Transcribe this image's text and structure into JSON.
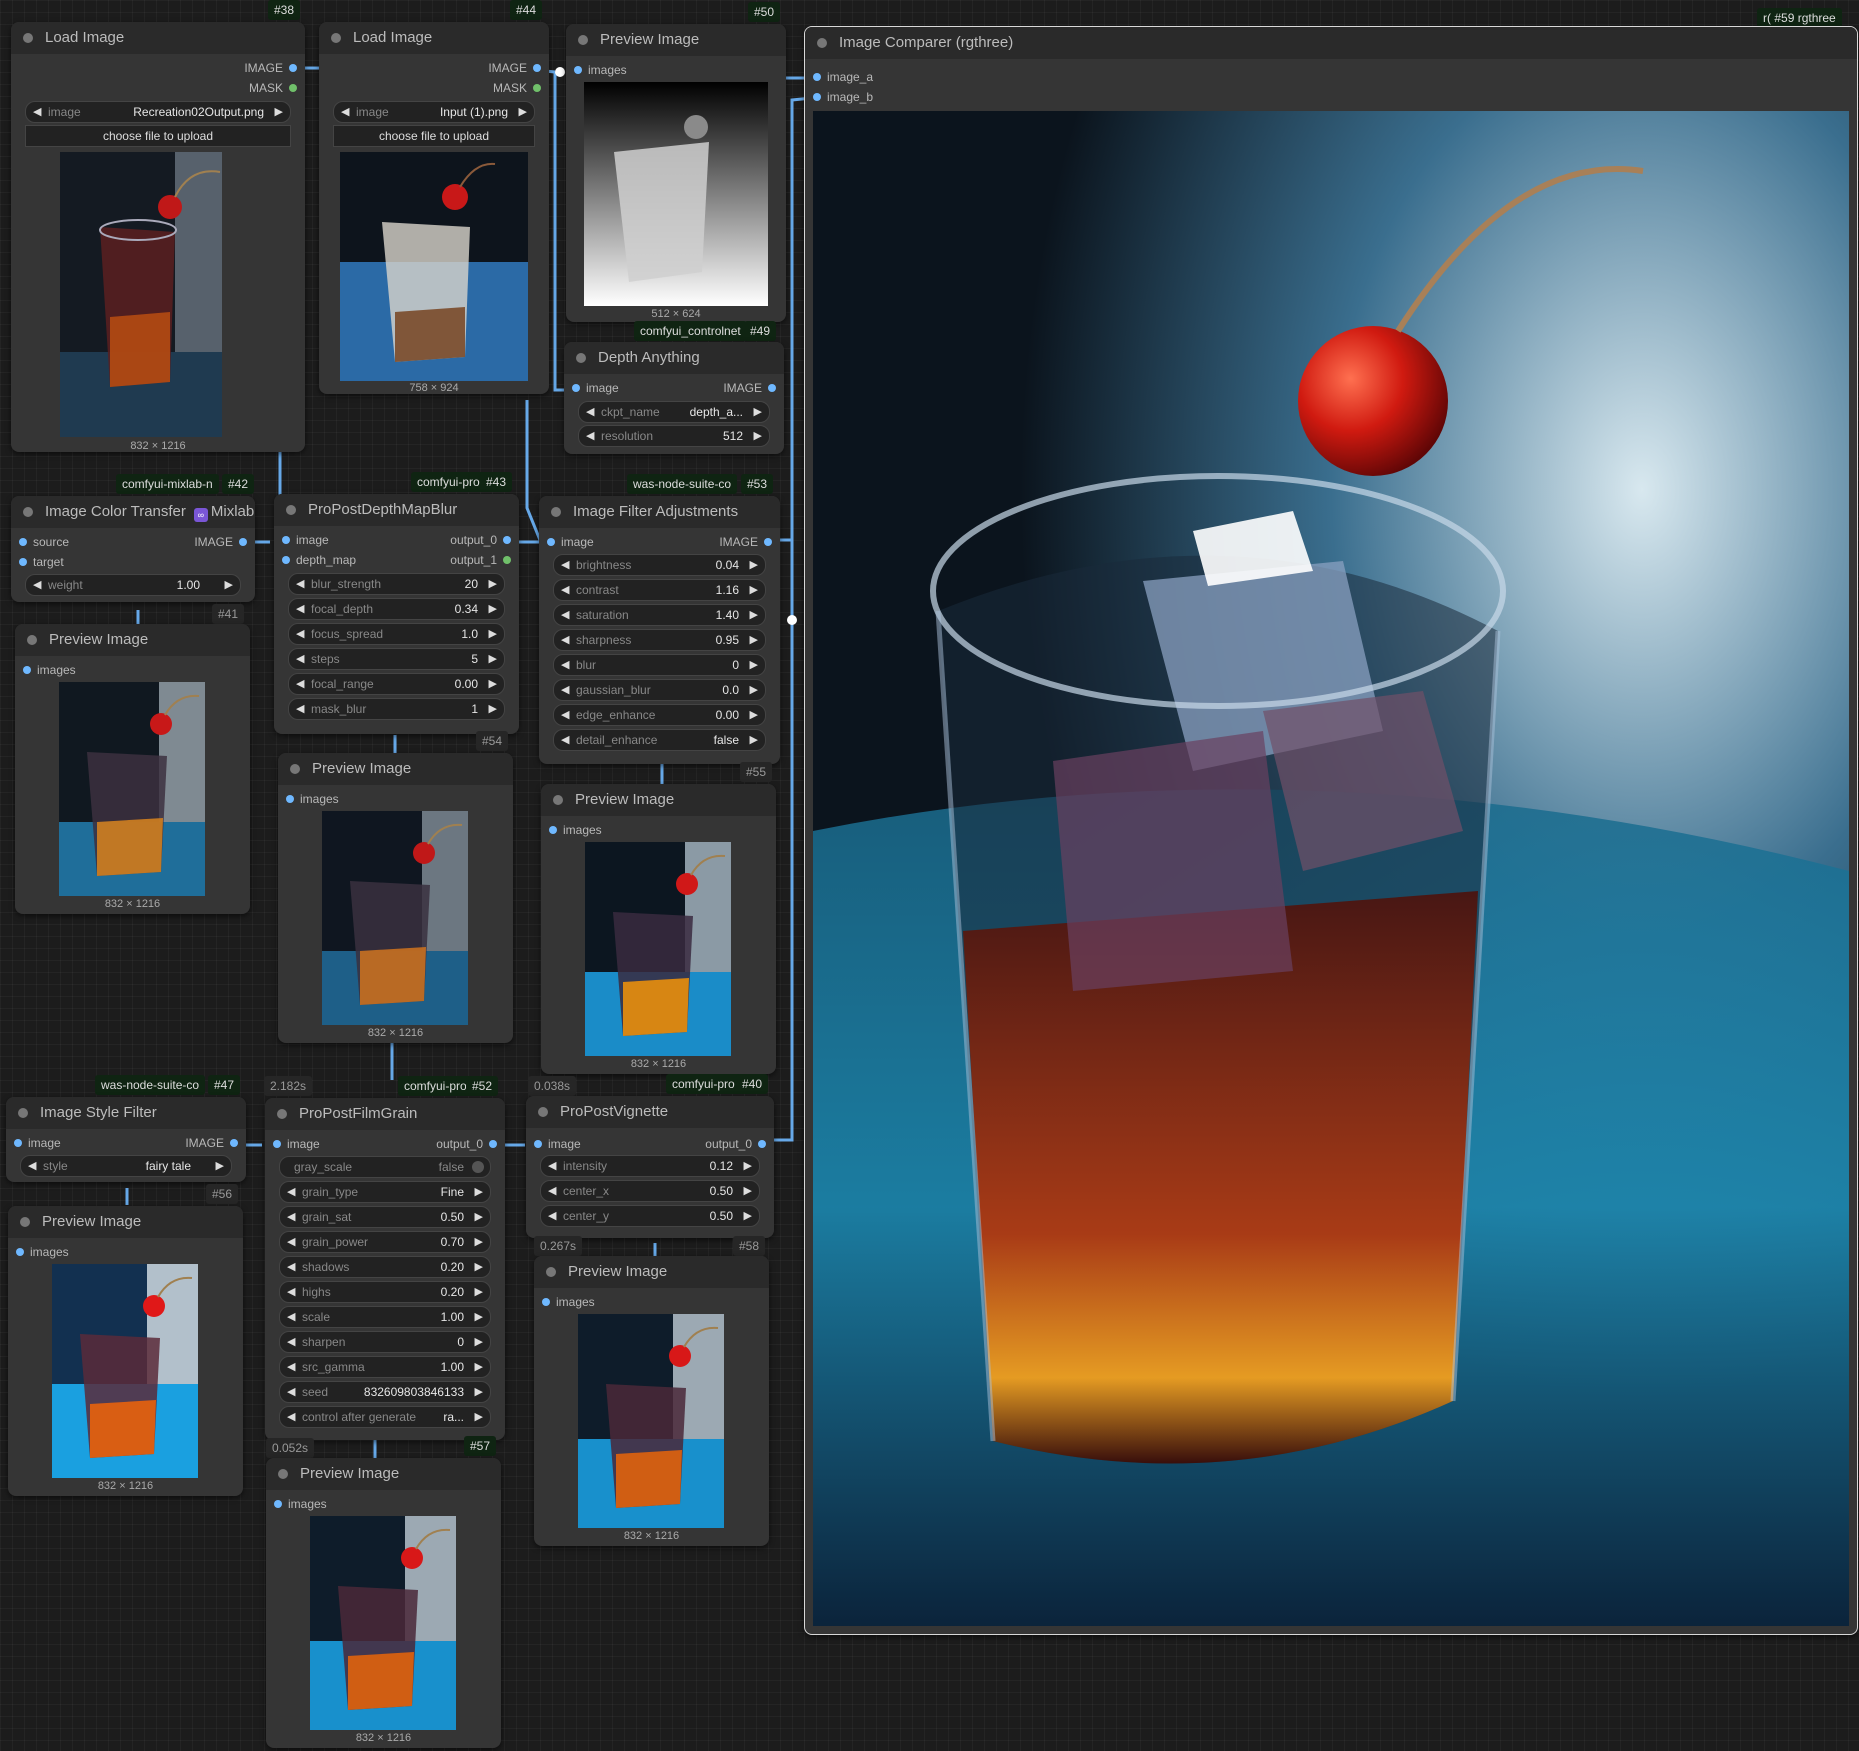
{
  "nodes": {
    "n38": {
      "id": "#38",
      "title": "Load Image",
      "out_image": "IMAGE",
      "out_mask": "MASK",
      "image_label": "image",
      "image_value": "Recreation02Output.png",
      "upload_label": "choose file to upload",
      "size": "832 × 1216"
    },
    "n44": {
      "id": "#44",
      "title": "Load Image",
      "out_image": "IMAGE",
      "out_mask": "MASK",
      "image_label": "image",
      "image_value": "Input (1).png",
      "upload_label": "choose file to upload",
      "size": "758 × 924"
    },
    "n50": {
      "id": "#50",
      "title": "Preview Image",
      "in_images": "images",
      "size": "512 × 624"
    },
    "n49": {
      "id": "#49",
      "badge": "comfyui_controlnet",
      "title": "Depth Anything",
      "in_image": "image",
      "out_image": "IMAGE",
      "widgets": [
        {
          "label": "ckpt_name",
          "value": "depth_a..."
        },
        {
          "label": "resolution",
          "value": "512"
        }
      ]
    },
    "n59": {
      "id": "#59 rgthree",
      "badge_prefix": "r(",
      "title": "Image Comparer (rgthree)",
      "in_a": "image_a",
      "in_b": "image_b"
    },
    "n42": {
      "id": "#42",
      "badge": "comfyui-mixlab-n",
      "title": "Image Color Transfer",
      "brand": "Mixlab",
      "brand_icon": "∞",
      "in_source": "source",
      "in_target": "target",
      "out_image": "IMAGE",
      "widgets": [
        {
          "label": "weight",
          "value": "1.00"
        }
      ]
    },
    "n43": {
      "id": "#43",
      "badge": "comfyui-pro",
      "title": "ProPostDepthMapBlur",
      "in_image": "image",
      "in_depth": "depth_map",
      "out_0": "output_0",
      "out_1": "output_1",
      "widgets": [
        {
          "label": "blur_strength",
          "value": "20"
        },
        {
          "label": "focal_depth",
          "value": "0.34"
        },
        {
          "label": "focus_spread",
          "value": "1.0"
        },
        {
          "label": "steps",
          "value": "5"
        },
        {
          "label": "focal_range",
          "value": "0.00"
        },
        {
          "label": "mask_blur",
          "value": "1"
        }
      ]
    },
    "n53": {
      "id": "#53",
      "badge": "was-node-suite-co",
      "title": "Image Filter Adjustments",
      "in_image": "image",
      "out_image": "IMAGE",
      "widgets": [
        {
          "label": "brightness",
          "value": "0.04"
        },
        {
          "label": "contrast",
          "value": "1.16"
        },
        {
          "label": "saturation",
          "value": "1.40"
        },
        {
          "label": "sharpness",
          "value": "0.95"
        },
        {
          "label": "blur",
          "value": "0"
        },
        {
          "label": "gaussian_blur",
          "value": "0.0"
        },
        {
          "label": "edge_enhance",
          "value": "0.00"
        },
        {
          "label": "detail_enhance",
          "value": "false"
        }
      ]
    },
    "n41": {
      "id": "#41",
      "title": "Preview Image",
      "in_images": "images",
      "size": "832 × 1216"
    },
    "n54": {
      "id": "#54",
      "title": "Preview Image",
      "in_images": "images",
      "size": "832 × 1216"
    },
    "n55": {
      "id": "#55",
      "title": "Preview Image",
      "in_images": "images",
      "size": "832 × 1216"
    },
    "n47": {
      "id": "#47",
      "badge": "was-node-suite-co",
      "title": "Image Style Filter",
      "in_image": "image",
      "out_image": "IMAGE",
      "widgets": [
        {
          "label": "style",
          "value": "fairy tale"
        }
      ]
    },
    "n52": {
      "id": "#52",
      "time": "2.182s",
      "badge": "comfyui-pro",
      "title": "ProPostFilmGrain",
      "in_image": "image",
      "out_0": "output_0",
      "toggle": {
        "label": "gray_scale",
        "value": "false"
      },
      "widgets": [
        {
          "label": "grain_type",
          "value": "Fine"
        },
        {
          "label": "grain_sat",
          "value": "0.50"
        },
        {
          "label": "grain_power",
          "value": "0.70"
        },
        {
          "label": "shadows",
          "value": "0.20"
        },
        {
          "label": "highs",
          "value": "0.20"
        },
        {
          "label": "scale",
          "value": "1.00"
        },
        {
          "label": "sharpen",
          "value": "0"
        },
        {
          "label": "src_gamma",
          "value": "1.00"
        }
      ],
      "seed": {
        "label": "seed",
        "value": "832609803846133"
      },
      "control": {
        "label": "control after generate",
        "value": "ra..."
      }
    },
    "n40": {
      "id": "#40",
      "time": "0.038s",
      "badge": "comfyui-pro",
      "title": "ProPostVignette",
      "in_image": "image",
      "out_0": "output_0",
      "widgets": [
        {
          "label": "intensity",
          "value": "0.12"
        },
        {
          "label": "center_x",
          "value": "0.50"
        },
        {
          "label": "center_y",
          "value": "0.50"
        }
      ]
    },
    "n56": {
      "id": "#56",
      "title": "Preview Image",
      "in_images": "images",
      "size": "832 × 1216"
    },
    "n57": {
      "id": "#57",
      "time": "0.052s",
      "title": "Preview Image",
      "in_images": "images",
      "size": "832 × 1216"
    },
    "n58": {
      "id": "#58",
      "time": "0.267s",
      "title": "Preview Image",
      "in_images": "images",
      "size": "832 × 1216"
    }
  },
  "icons": {
    "arrow_left": "◀",
    "arrow_right": "▶"
  },
  "colors": {
    "canvas": "#1c1c1c",
    "node": "#353535",
    "header": "#2a2a2a",
    "wire_image": "#6fb8ff",
    "wire_mask": "#70c06a",
    "badge": "#0f2412"
  }
}
